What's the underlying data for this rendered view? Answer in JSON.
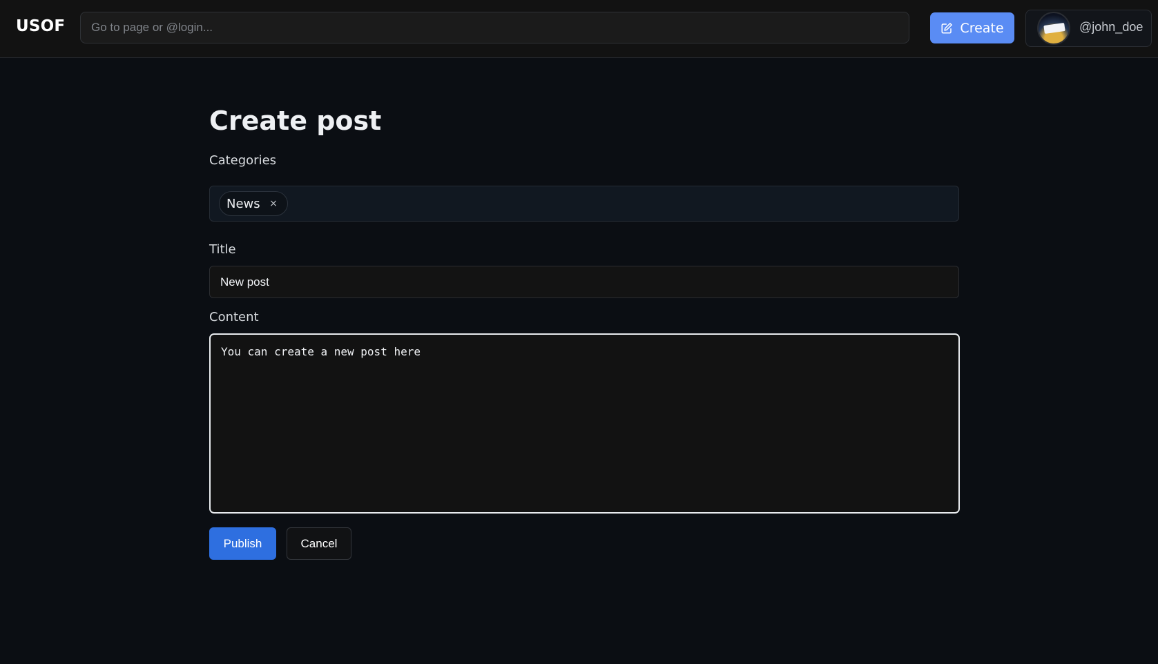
{
  "app": {
    "logo": "USOF"
  },
  "header": {
    "search_placeholder": "Go to page or @login...",
    "create_label": "Create",
    "username": "@john_doe"
  },
  "page": {
    "title": "Create post",
    "categories_label": "Categories",
    "categories": [
      {
        "label": "News",
        "remove": "×"
      }
    ],
    "title_label": "Title",
    "title_value": "New post",
    "content_label": "Content",
    "content_value": "You can create a new post here",
    "publish_label": "Publish",
    "cancel_label": "Cancel"
  },
  "colors": {
    "background": "#0b0e13",
    "accent": "#5a8cf4",
    "primary_button": "#2e6fe0"
  }
}
